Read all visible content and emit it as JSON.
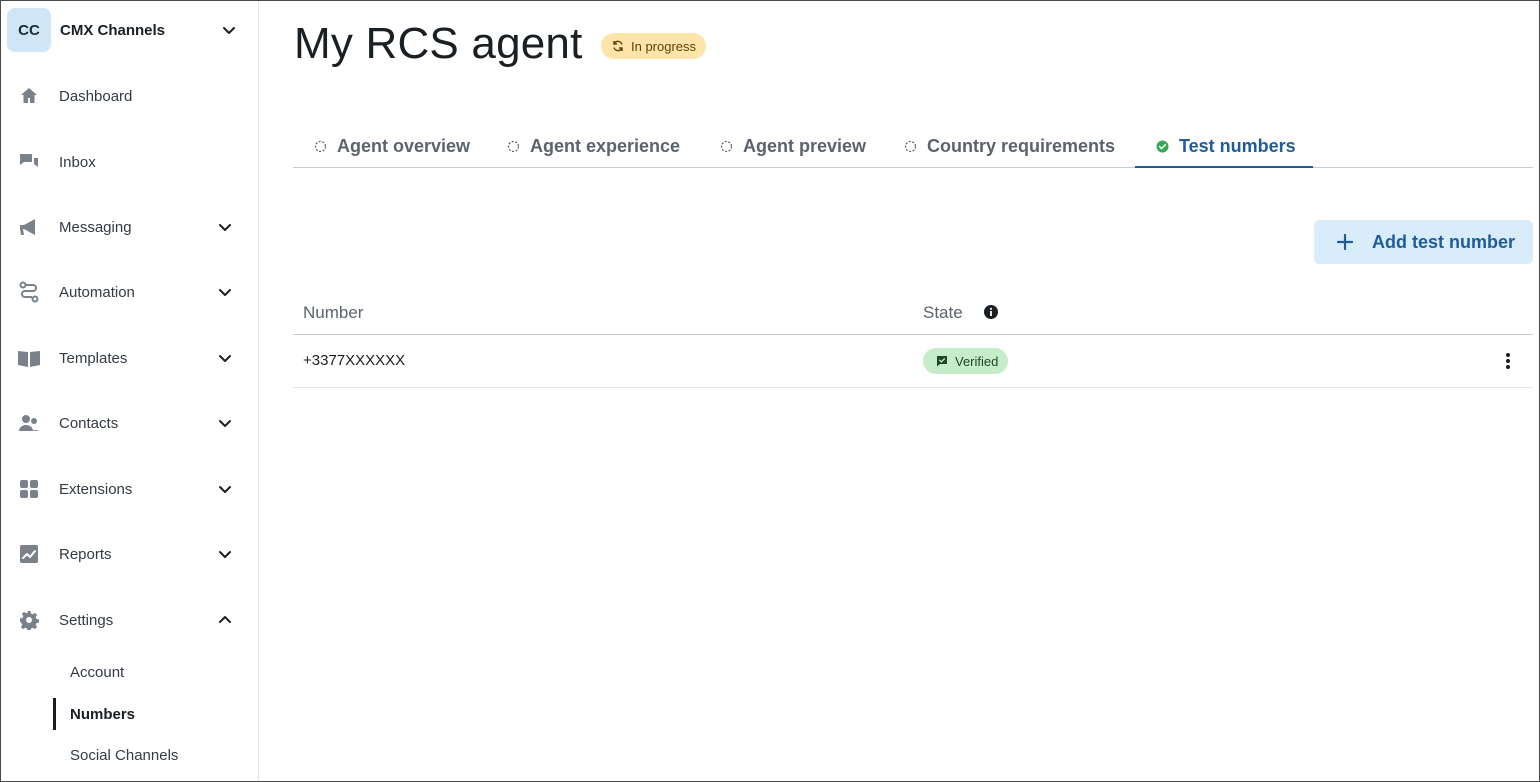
{
  "org": {
    "initials": "CC",
    "name": "CMX Channels"
  },
  "nav": [
    {
      "label": "Dashboard",
      "icon": "home-icon",
      "expandable": false
    },
    {
      "label": "Inbox",
      "icon": "chat-bubbles-icon",
      "expandable": false
    },
    {
      "label": "Messaging",
      "icon": "megaphone-icon",
      "expandable": true
    },
    {
      "label": "Automation",
      "icon": "route-icon",
      "expandable": true
    },
    {
      "label": "Templates",
      "icon": "book-open-icon",
      "expandable": true
    },
    {
      "label": "Contacts",
      "icon": "people-icon",
      "expandable": true
    },
    {
      "label": "Extensions",
      "icon": "apps-grid-icon",
      "expandable": true
    },
    {
      "label": "Reports",
      "icon": "chart-trend-icon",
      "expandable": true
    },
    {
      "label": "Settings",
      "icon": "gear-icon",
      "expandable": true,
      "expanded": true
    }
  ],
  "settings_sub": [
    {
      "label": "Account",
      "active": false
    },
    {
      "label": "Numbers",
      "active": true
    },
    {
      "label": "Social Channels",
      "active": false
    }
  ],
  "page": {
    "title": "My RCS agent",
    "status": "In progress"
  },
  "tabs": [
    {
      "label": "Agent overview",
      "state": "incomplete"
    },
    {
      "label": "Agent experience",
      "state": "incomplete"
    },
    {
      "label": "Agent preview",
      "state": "incomplete"
    },
    {
      "label": "Country requirements",
      "state": "incomplete"
    },
    {
      "label": "Test numbers",
      "state": "complete",
      "active": true
    }
  ],
  "actions": {
    "add_test_number": "Add test number"
  },
  "table": {
    "columns": [
      "Number",
      "State"
    ],
    "rows": [
      {
        "number": "+3377XXXXXX",
        "state": "Verified"
      }
    ]
  },
  "colors": {
    "accent": "#1f5d99",
    "status_in_progress_bg": "#fde4a8",
    "verified_bg": "#c6ecc9",
    "button_bg": "#d9ecfa",
    "tab_complete_check": "#3aa757"
  }
}
